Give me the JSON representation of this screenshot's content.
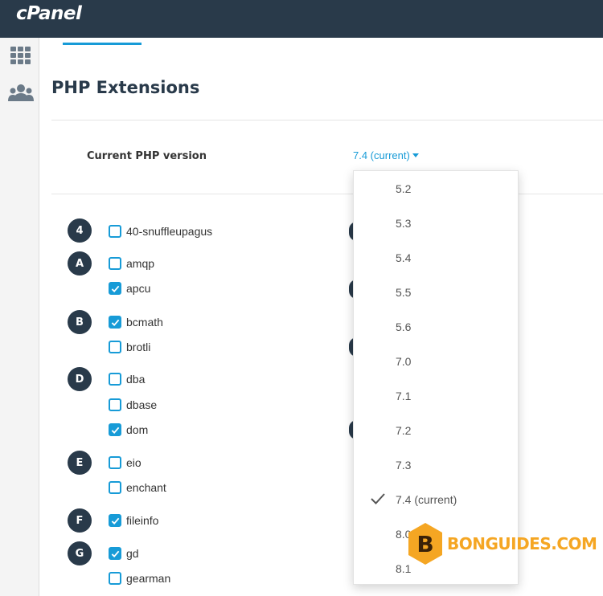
{
  "app": {
    "logo": "cPanel"
  },
  "page": {
    "title": "PHP Extensions"
  },
  "php_version": {
    "label": "Current PHP version",
    "current": "7.4 (current)"
  },
  "dropdown": {
    "options": [
      "5.2",
      "5.3",
      "5.4",
      "5.5",
      "5.6",
      "7.0",
      "7.1",
      "7.2",
      "7.3",
      "7.4 (current)",
      "8.0",
      "8.1"
    ],
    "selected": "7.4 (current)"
  },
  "letters": [
    "4",
    "A",
    "B",
    "D",
    "E",
    "F",
    "G"
  ],
  "extensions": [
    {
      "name": "40-snuffleupagus",
      "checked": false
    },
    {
      "name": "amqp",
      "checked": false
    },
    {
      "name": "apcu",
      "checked": true
    },
    {
      "name": "bcmath",
      "checked": true
    },
    {
      "name": "brotli",
      "checked": false
    },
    {
      "name": "dba",
      "checked": false
    },
    {
      "name": "dbase",
      "checked": false
    },
    {
      "name": "dom",
      "checked": true
    },
    {
      "name": "eio",
      "checked": false
    },
    {
      "name": "enchant",
      "checked": false
    },
    {
      "name": "fileinfo",
      "checked": true
    },
    {
      "name": "gd",
      "checked": true
    },
    {
      "name": "gearman",
      "checked": false
    }
  ],
  "watermark": {
    "text": "BONGUIDES.COM",
    "mark": "B"
  },
  "colors": {
    "topbar": "#293a4a",
    "accent": "#179bd7",
    "watermark": "#f5a623"
  }
}
